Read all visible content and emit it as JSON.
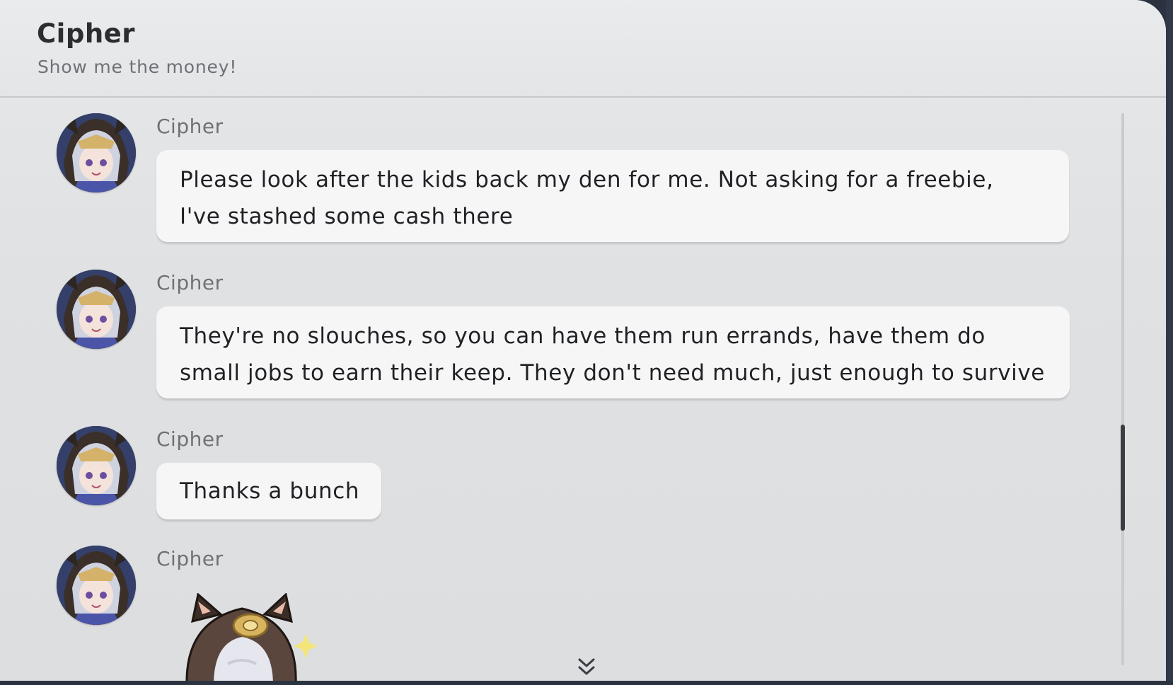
{
  "header": {
    "title": "Cipher",
    "subtitle": "Show me the money!"
  },
  "messages": [
    {
      "sender": "Cipher",
      "lines": [
        "Please look after the kids back my den for me. Not asking for a freebie,",
        "I've stashed some cash there"
      ]
    },
    {
      "sender": "Cipher",
      "lines": [
        "They're no slouches, so you can have them run errands, have them do",
        "small jobs to earn their keep. They don't need much, just enough to survive"
      ]
    },
    {
      "sender": "Cipher",
      "lines": [
        "Thanks a bunch"
      ]
    },
    {
      "sender": "Cipher",
      "sticker": "cipher-cat-hood-sticker"
    }
  ],
  "icons": {
    "avatar": "cipher-avatar-icon",
    "scroll_more": "double-chevron-down-icon"
  },
  "colors": {
    "panel_bg": "#e3e5e7",
    "bubble_bg": "#f6f6f7",
    "text": "#1f2124",
    "sender_text": "#6f7275",
    "scroll_thumb": "#3a3d42"
  }
}
